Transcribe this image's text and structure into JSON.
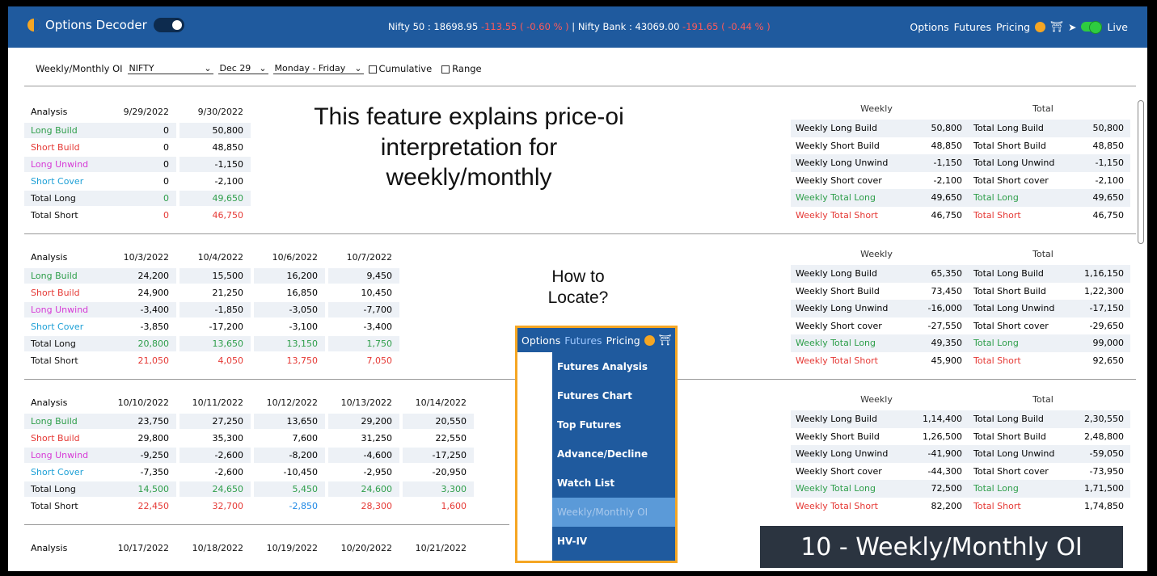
{
  "header": {
    "app_title": "Options Decoder",
    "ticker_nifty_label": "Nifty 50 : 18698.95",
    "ticker_nifty_change": "-113.55 ( -0.60 % )",
    "ticker_sep": "|",
    "ticker_bank_label": "Nifty Bank : 43069.00",
    "ticker_bank_change": "-191.65 ( -0.44 % )",
    "nav": [
      "Options",
      "Futures",
      "Pricing"
    ],
    "live_label": "Live"
  },
  "filters": {
    "label": "Weekly/Monthly OI",
    "symbol": "NIFTY",
    "expiry": "Dec 29",
    "days": "Monday - Friday",
    "cumulative": "Cumulative",
    "range": "Range"
  },
  "row_labels": [
    "Analysis",
    "Long Build",
    "Short Build",
    "Long Unwind",
    "Short Cover",
    "Total Long",
    "Total Short"
  ],
  "sections": [
    {
      "dates": [
        "9/29/2022",
        "9/30/2022"
      ],
      "rows": [
        [
          "0",
          "50,800"
        ],
        [
          "0",
          "48,850"
        ],
        [
          "0",
          "-1,150"
        ],
        [
          "0",
          "-2,100"
        ],
        [
          "0",
          "49,650"
        ],
        [
          "0",
          "46,750"
        ]
      ]
    },
    {
      "dates": [
        "10/3/2022",
        "10/4/2022",
        "10/6/2022",
        "10/7/2022"
      ],
      "rows": [
        [
          "24,200",
          "15,500",
          "16,200",
          "9,450"
        ],
        [
          "24,900",
          "21,250",
          "16,850",
          "10,450"
        ],
        [
          "-3,400",
          "-1,850",
          "-3,050",
          "-7,700"
        ],
        [
          "-3,850",
          "-17,200",
          "-3,100",
          "-3,400"
        ],
        [
          "20,800",
          "13,650",
          "13,150",
          "1,750"
        ],
        [
          "21,050",
          "4,050",
          "13,750",
          "7,050"
        ]
      ]
    },
    {
      "dates": [
        "10/10/2022",
        "10/11/2022",
        "10/12/2022",
        "10/13/2022",
        "10/14/2022"
      ],
      "rows": [
        [
          "23,750",
          "27,250",
          "13,650",
          "29,200",
          "20,550"
        ],
        [
          "29,800",
          "35,300",
          "7,600",
          "31,250",
          "22,550"
        ],
        [
          "-9,250",
          "-2,600",
          "-8,200",
          "-4,600",
          "-17,250"
        ],
        [
          "-7,350",
          "-2,600",
          "-10,450",
          "-2,950",
          "-20,950"
        ],
        [
          "14,500",
          "24,650",
          "5,450",
          "24,600",
          "3,300"
        ],
        [
          "22,450",
          "32,700",
          "-2,850",
          "28,300",
          "1,600"
        ]
      ]
    },
    {
      "dates": [
        "10/17/2022",
        "10/18/2022",
        "10/19/2022",
        "10/20/2022",
        "10/21/2022"
      ],
      "rows": []
    }
  ],
  "summary_headers": [
    "Weekly",
    "Total"
  ],
  "summary_keys": [
    "Weekly Long Build",
    "Weekly Short Build",
    "Weekly Long Unwind",
    "Weekly Short cover",
    "Weekly Total Long",
    "Weekly Total Short"
  ],
  "summary_total_keys": [
    "Total Long Build",
    "Total Short Build",
    "Total Long Unwind",
    "Total Short cover",
    "Total Long",
    "Total Short"
  ],
  "summaries": [
    {
      "weekly": [
        "50,800",
        "48,850",
        "-1,150",
        "-2,100",
        "49,650",
        "46,750"
      ],
      "total": [
        "50,800",
        "48,850",
        "-1,150",
        "-2,100",
        "49,650",
        "46,750"
      ]
    },
    {
      "weekly": [
        "65,350",
        "73,450",
        "-16,000",
        "-27,550",
        "49,350",
        "45,900"
      ],
      "total": [
        "1,16,150",
        "1,22,300",
        "-17,150",
        "-29,650",
        "99,000",
        "92,650"
      ]
    },
    {
      "weekly": [
        "1,14,400",
        "1,26,500",
        "-41,900",
        "-44,300",
        "72,500",
        "82,200"
      ],
      "total": [
        "2,30,550",
        "2,48,800",
        "-59,050",
        "-73,950",
        "1,71,500",
        "1,74,850"
      ]
    }
  ],
  "overlay": {
    "title_line1": "This feature explains price-oi",
    "title_line2": "interpretation for",
    "title_line3": "weekly/monthly",
    "howto_line1": "How to",
    "howto_line2": "Locate?"
  },
  "menu": {
    "top_items": [
      "Options",
      "Futures",
      "Pricing"
    ],
    "items": [
      "Futures Analysis",
      "Futures Chart",
      "Top Futures",
      "Advance/Decline",
      "Watch List",
      "Weekly/Monthly OI",
      "HV-IV"
    ]
  },
  "badge": "10 - Weekly/Monthly OI"
}
